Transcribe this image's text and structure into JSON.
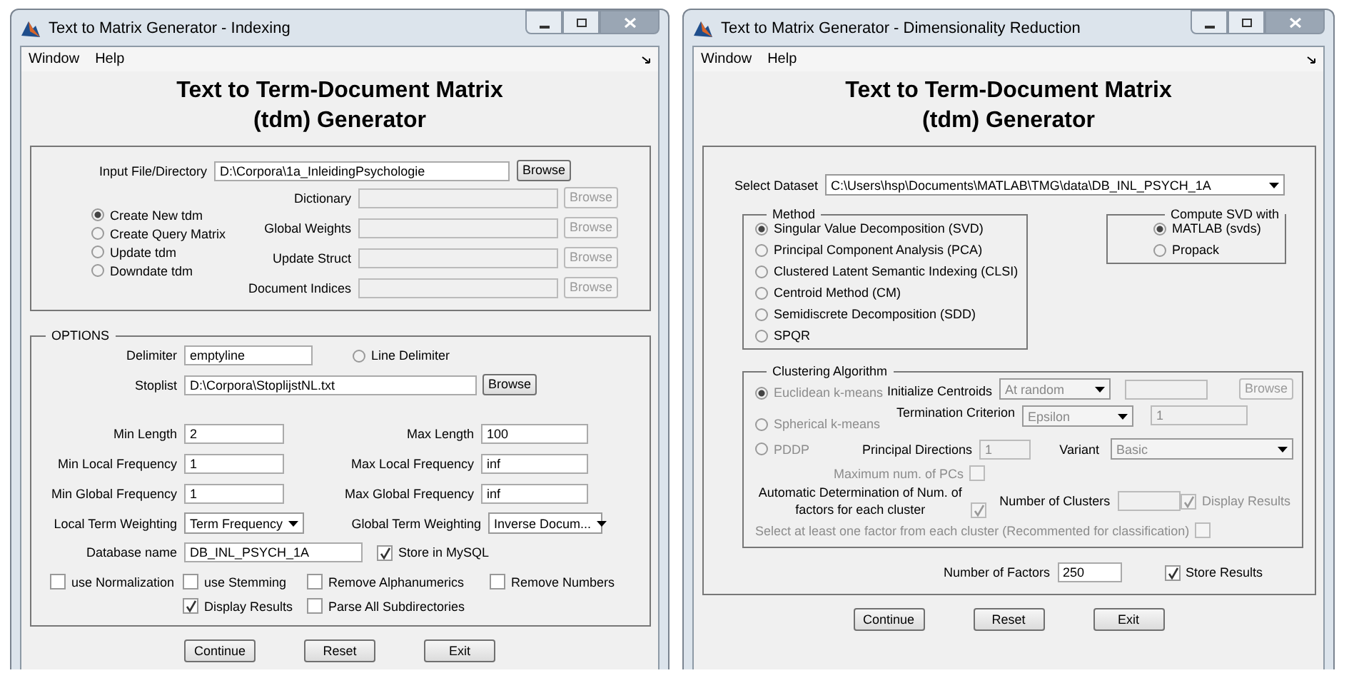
{
  "indexing_window": {
    "title": "Text to Matrix Generator - Indexing",
    "menu": [
      "Window",
      "Help"
    ],
    "heading": [
      "Text to Term-Document Matrix",
      "(tdm) Generator"
    ],
    "input": {
      "label": "Input File/Directory",
      "value": "D:\\Corpora\\1a_InleidingPsychologie",
      "button": "Browse"
    },
    "modes": [
      {
        "label": "Create New tdm",
        "selected": true
      },
      {
        "label": "Create Query Matrix",
        "selected": false
      },
      {
        "label": "Update tdm",
        "selected": false
      },
      {
        "label": "Downdate tdm",
        "selected": false
      }
    ],
    "file_fields": [
      {
        "label": "Dictionary",
        "button": "Browse",
        "disabled": true
      },
      {
        "label": "Global Weights",
        "button": "Browse",
        "disabled": true
      },
      {
        "label": "Update Struct",
        "button": "Browse",
        "disabled": true
      },
      {
        "label": "Document Indices",
        "button": "Browse",
        "disabled": true
      }
    ],
    "options": {
      "title": "OPTIONS",
      "delimiter": {
        "label": "Delimiter",
        "value": "emptyline"
      },
      "line_delimiter": {
        "label": "Line Delimiter",
        "selected": false
      },
      "stoplist": {
        "label": "Stoplist",
        "value": "D:\\Corpora\\StoplijstNL.txt",
        "button": "Browse"
      },
      "limits": [
        {
          "label": "Min Length",
          "value": "2"
        },
        {
          "label": "Max Length",
          "value": "100"
        },
        {
          "label": "Min Local Frequency",
          "value": "1"
        },
        {
          "label": "Max Local Frequency",
          "value": "inf"
        },
        {
          "label": "Min Global Frequency",
          "value": "1"
        },
        {
          "label": "Max Global Frequency",
          "value": "inf"
        }
      ],
      "weighting": [
        {
          "label": "Local Term Weighting",
          "value": "Term Frequency"
        },
        {
          "label": "Global Term Weighting",
          "value": "Inverse Docum..."
        }
      ],
      "database": {
        "label": "Database name",
        "value": "DB_INL_PSYCH_1A"
      },
      "store_mysql": {
        "label": "Store in MySQL",
        "checked": true
      },
      "checkbox_rows": [
        [
          {
            "label": "use Normalization",
            "checked": false
          },
          {
            "label": "use Stemming",
            "checked": false
          },
          {
            "label": "Remove Alphanumerics",
            "checked": false
          },
          {
            "label": "Remove Numbers",
            "checked": false
          }
        ],
        [
          {
            "label": "Display Results",
            "checked": true
          },
          {
            "label": "Parse All Subdirectories",
            "checked": false
          }
        ]
      ]
    },
    "buttons": [
      "Continue",
      "Reset",
      "Exit"
    ]
  },
  "reduction_window": {
    "title": "Text to Matrix Generator - Dimensionality Reduction",
    "menu": [
      "Window",
      "Help"
    ],
    "heading": [
      "Text to Term-Document Matrix",
      "(tdm) Generator"
    ],
    "dataset": {
      "label": "Select Dataset",
      "value": "C:\\Users\\hsp\\Documents\\MATLAB\\TMG\\data\\DB_INL_PSYCH_1A"
    },
    "method": {
      "title": "Method",
      "options": [
        {
          "label": "Singular Value Decomposition (SVD)",
          "selected": true
        },
        {
          "label": "Principal Component Analysis (PCA)",
          "selected": false
        },
        {
          "label": "Clustered Latent Semantic Indexing (CLSI)",
          "selected": false
        },
        {
          "label": "Centroid Method (CM)",
          "selected": false
        },
        {
          "label": "Semidiscrete Decomposition (SDD)",
          "selected": false
        },
        {
          "label": "SPQR",
          "selected": false
        }
      ]
    },
    "svd": {
      "title": "Compute SVD with",
      "options": [
        {
          "label": "MATLAB (svds)",
          "selected": true
        },
        {
          "label": "Propack",
          "selected": false
        }
      ]
    },
    "clustering": {
      "title": "Clustering Algorithm",
      "disabled": true,
      "algorithms": [
        {
          "label": "Euclidean k-means",
          "selected": true
        },
        {
          "label": "Spherical k-means",
          "selected": false
        },
        {
          "label": "PDDP",
          "selected": false
        }
      ],
      "init": {
        "label": "Initialize Centroids",
        "value": "At random",
        "button": "Browse"
      },
      "termination": {
        "label": "Termination Criterion",
        "value": "Epsilon",
        "field": "1"
      },
      "principal": {
        "label": "Principal Directions",
        "value": "1"
      },
      "variant": {
        "label": "Variant",
        "value": "Basic"
      },
      "max_pcs": {
        "label": "Maximum num. of PCs",
        "checked": false
      },
      "auto": {
        "label": "Automatic Determination of Num. of factors for each cluster",
        "checked": true
      },
      "clusters": {
        "label": "Number of Clusters"
      },
      "display": {
        "label": "Display Results",
        "checked": true
      },
      "select_one": {
        "label": "Select at least one factor from each cluster (Recommented for classification)",
        "checked": false
      }
    },
    "factors": {
      "label": "Number of Factors",
      "value": "250"
    },
    "store": {
      "label": "Store Results",
      "checked": true
    },
    "buttons": [
      "Continue",
      "Reset",
      "Exit"
    ]
  }
}
